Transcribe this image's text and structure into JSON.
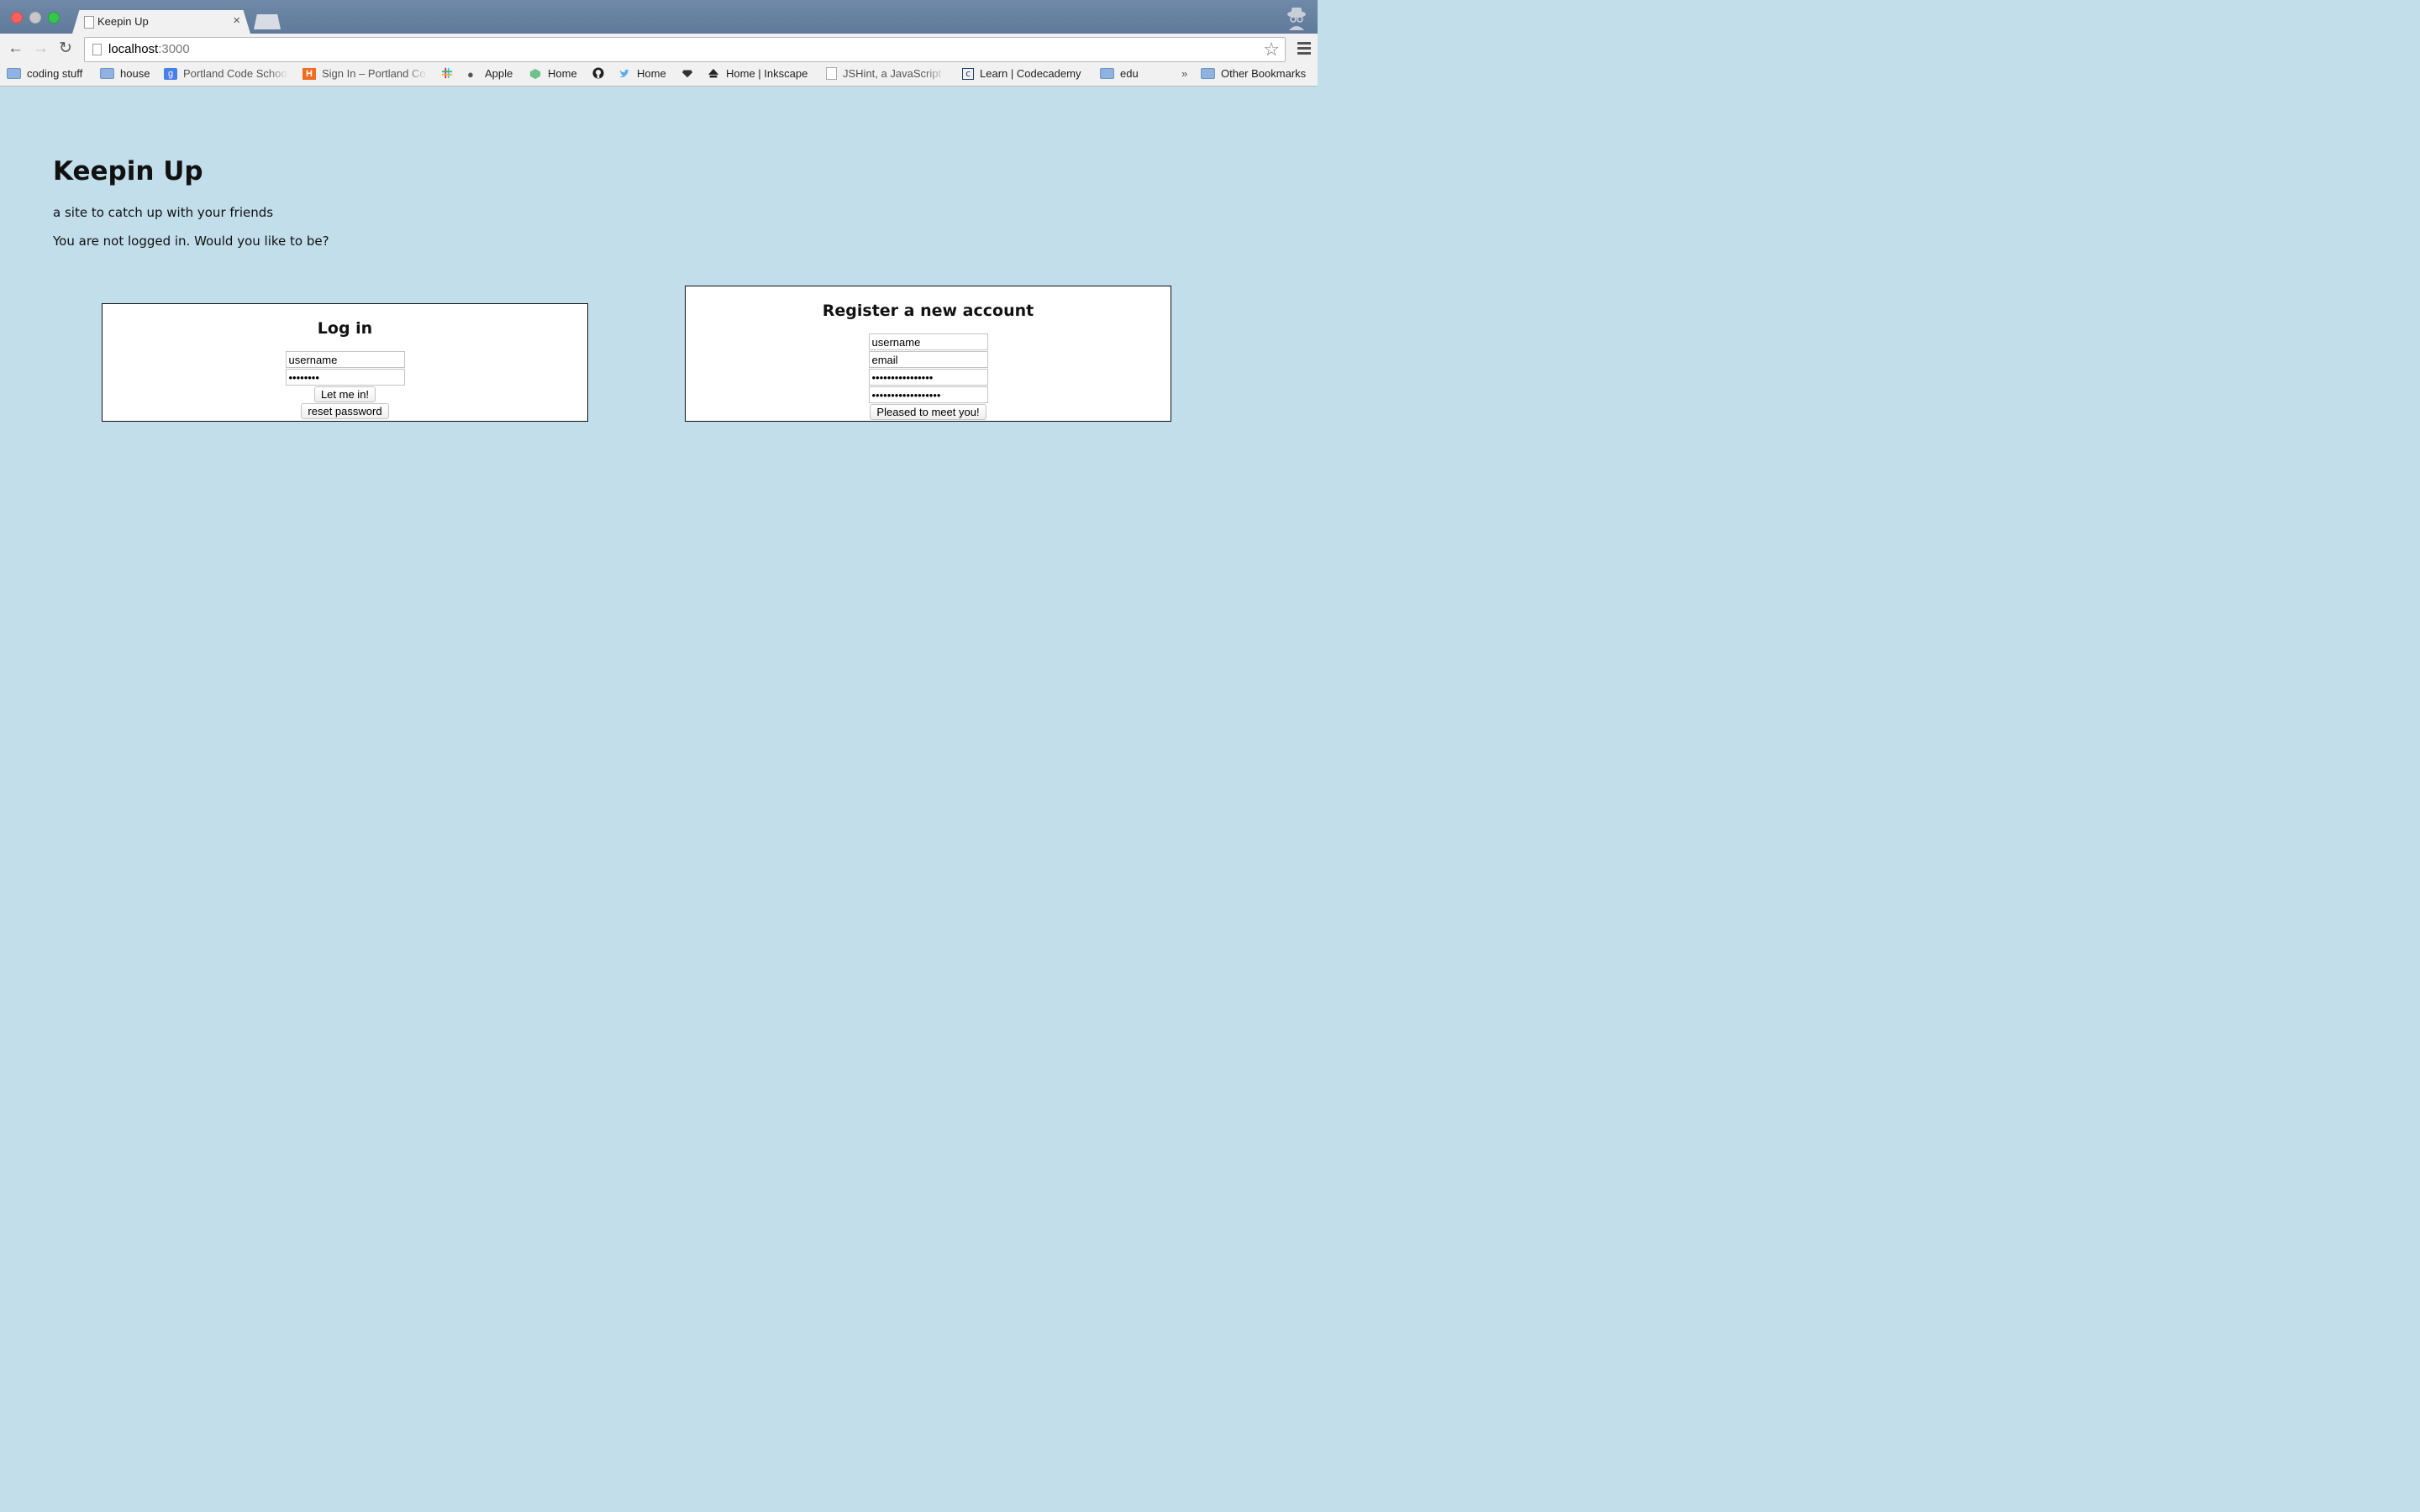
{
  "browser": {
    "tab_title": "Keepin Up",
    "tab_close": "×",
    "url_host": "localhost",
    "url_port": ":3000",
    "bookmarks": [
      {
        "label": "coding stuff",
        "icon": "folder-icon"
      },
      {
        "label": "house",
        "icon": "folder-icon"
      },
      {
        "label": "Portland Code Schoo",
        "icon": "google-icon"
      },
      {
        "label": "Sign In – Portland Co",
        "icon": "h-logo-icon"
      },
      {
        "label": "",
        "icon": "slack-icon"
      },
      {
        "label": "Apple",
        "icon": "apple-icon"
      },
      {
        "label": "Home",
        "icon": "green-icon"
      },
      {
        "label": "",
        "icon": "github-icon"
      },
      {
        "label": "Home",
        "icon": "twitter-icon"
      },
      {
        "label": "",
        "icon": "gem-icon"
      },
      {
        "label": "Home | Inkscape",
        "icon": "inkscape-icon"
      },
      {
        "label": "JSHint, a JavaScript",
        "icon": "page-icon"
      },
      {
        "label": "Learn | Codecademy",
        "icon": "codecademy-icon"
      },
      {
        "label": "edu",
        "icon": "folder-icon"
      }
    ],
    "overflow": "»",
    "other_bookmarks": "Other Bookmarks"
  },
  "page": {
    "title": "Keepin Up",
    "tagline": "a site to catch up with your friends",
    "status": "You are not logged in. Would you like to be?"
  },
  "login": {
    "heading": "Log in",
    "username_value": "username",
    "password_value": "password",
    "submit": "Let me in!",
    "reset": "reset password"
  },
  "register": {
    "heading": "Register a new account",
    "username_value": "username",
    "email_value": "email",
    "password_value": "passwordpassword",
    "confirm_value": "passwordpasswordpa",
    "submit": "Pleased to meet you!"
  },
  "colors": {
    "page_background": "#c1deea",
    "panel_background": "#ffffff"
  }
}
